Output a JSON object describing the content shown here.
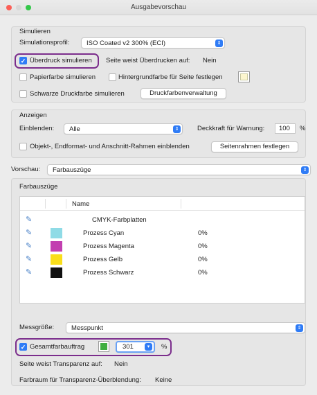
{
  "window": {
    "title": "Ausgabevorschau"
  },
  "simulieren": {
    "heading": "Simulieren",
    "profil_label": "Simulationsprofil:",
    "profil_value": "ISO Coated v2 300% (ECI)",
    "ueberdruck_label": "Überdruck simulieren",
    "ueberdruck_checked": true,
    "seite_ueberdruck_label": "Seite weist Überdrucken auf:",
    "seite_ueberdruck_value": "Nein",
    "papierfarbe_label": "Papierfarbe simulieren",
    "hintergrund_label": "Hintergrundfarbe für Seite festlegen",
    "schwarz_label": "Schwarze Druckfarbe simulieren",
    "druckfarben_button": "Druckfarbenverwaltung"
  },
  "anzeigen": {
    "heading": "Anzeigen",
    "einblenden_label": "Einblenden:",
    "einblenden_value": "Alle",
    "deckkraft_label": "Deckkraft für Warnung:",
    "deckkraft_value": "100",
    "deckkraft_unit": "%",
    "rahmen_label": "Objekt-, Endformat- und Anschnitt-Rahmen einblenden",
    "seitenrahmen_button": "Seitenrahmen festlegen"
  },
  "vorschau": {
    "label": "Vorschau:",
    "value": "Farbauszüge"
  },
  "farbauszuege": {
    "heading": "Farbauszüge",
    "column_name": "Name",
    "rows": [
      {
        "name": "CMYK-Farbplatten",
        "value": "",
        "color": ""
      },
      {
        "name": "Prozess Cyan",
        "value": "0%",
        "color": "#8fdbe6"
      },
      {
        "name": "Prozess Magenta",
        "value": "0%",
        "color": "#c23fb0"
      },
      {
        "name": "Prozess Gelb",
        "value": "0%",
        "color": "#f9de1a"
      },
      {
        "name": "Prozess Schwarz",
        "value": "0%",
        "color": "#111111"
      }
    ]
  },
  "messgroesse": {
    "label": "Messgröße:",
    "value": "Messpunkt"
  },
  "gesamtfarbauftrag": {
    "label": "Gesamtfarbauftrag",
    "checked": true,
    "swatch_color": "#3fae3f",
    "value": "301",
    "unit": "%"
  },
  "transparenz": {
    "label": "Seite weist Transparenz auf:",
    "value": "Nein",
    "farbraum_label": "Farbraum für Transparenz-Überblendung:",
    "farbraum_value": "Keine"
  },
  "colors": {
    "accent": "#2f7cf6",
    "highlight": "#7b2d8c"
  }
}
